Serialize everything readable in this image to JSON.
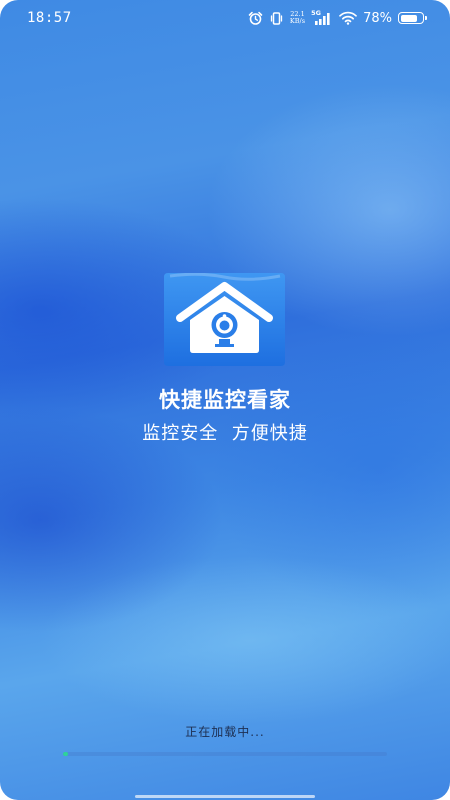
{
  "status_bar": {
    "time": "18:57",
    "net_speed_value": "22.1",
    "net_speed_unit": "KB/s",
    "network_type": "5G",
    "battery_percent": "78%",
    "battery_level": 0.78
  },
  "app": {
    "name": "快捷监控看家",
    "slogan": "监控安全  方便快捷"
  },
  "loading": {
    "text": "正在加载中...",
    "progress": 0.01
  },
  "colors": {
    "logo_background": "#2a7ee8",
    "progress_fill": "#2fd29a"
  },
  "icons": [
    "alarm-clock-icon",
    "vibrate-icon",
    "signal-icon",
    "wifi-icon",
    "battery-icon",
    "house-camera-logo"
  ]
}
